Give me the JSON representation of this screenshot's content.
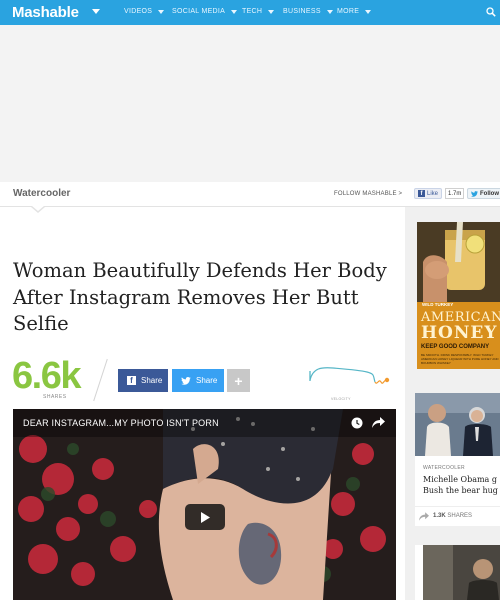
{
  "topnav": {
    "logo": "Mashable",
    "items": [
      {
        "label": "VIDEOS"
      },
      {
        "label": "SOCIAL MEDIA"
      },
      {
        "label": "TECH"
      },
      {
        "label": "BUSINESS"
      },
      {
        "label": "MORE"
      }
    ],
    "search_icon": "search-icon",
    "color": "#2aa3e0"
  },
  "channel": {
    "title": "Watercooler",
    "follow": "FOLLOW MASHABLE >",
    "fb_like": {
      "label": "Like",
      "count": "1.7m"
    },
    "tw_follow": {
      "label": "Follow"
    }
  },
  "article": {
    "headline": "Woman Beautifully Defends Her Body After Instagram Removes Her Butt Selfie",
    "shares": {
      "count": "6.6k",
      "label": "SHARES",
      "color": "#8ac641"
    },
    "share_buttons": {
      "facebook": "Share",
      "twitter": "Share",
      "more": "+"
    },
    "velocity_label": "VELOCITY",
    "video": {
      "caption": "DEAR INSTAGRAM...MY PHOTO ISN'T PORN",
      "icons": [
        "clock-icon",
        "share-arrow-icon",
        "play-icon"
      ]
    }
  },
  "sidebar": {
    "ad": {
      "brand": "WILD TURKEY",
      "line1": "AMERICAN",
      "line2": "HONEY",
      "tagline": "KEEP GOOD COMPANY",
      "fine_print": "BE SMOOTH. DRINK RESPONSIBLY. WILD TURKEY AMERICAN HONEY LIQUEUR WITH PURE HONEY AND BOURBON WHISKEY"
    },
    "story": {
      "channel": "WATERCOOLER",
      "title_line1": "Michelle Obama g",
      "title_line2": "Bush the bear hug",
      "shares": "1.3K",
      "shares_label": "SHARES"
    }
  }
}
